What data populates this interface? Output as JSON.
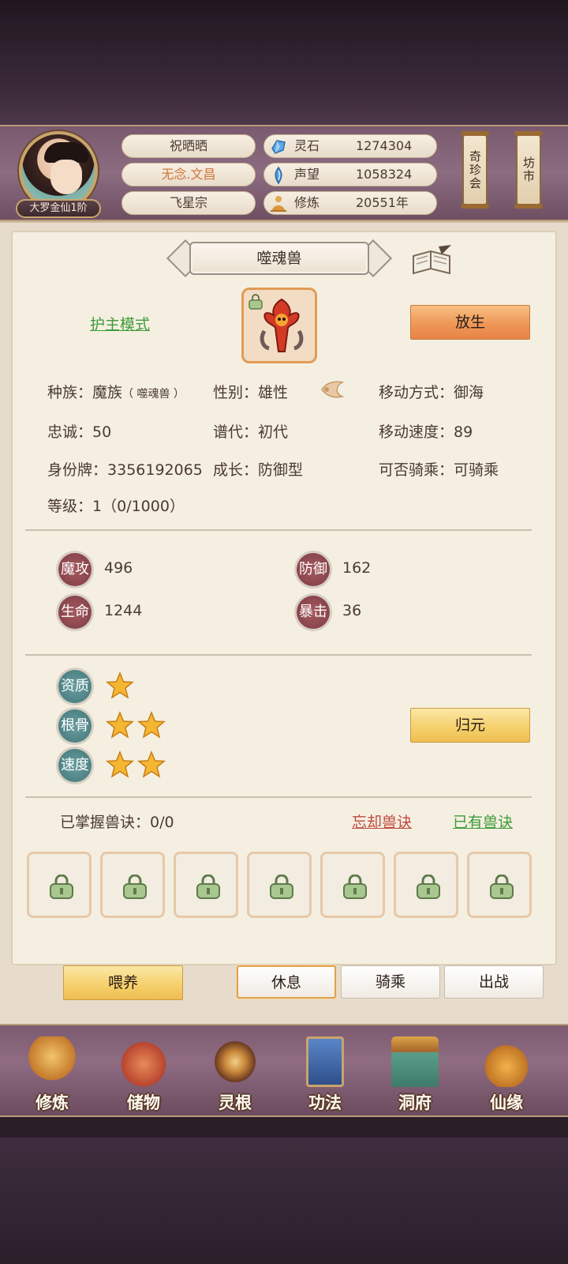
{
  "header": {
    "player_name": "祝晒晒",
    "title_name": "无念.文昌",
    "sect": "飞星宗",
    "rank": "大罗金仙1阶",
    "stats": [
      {
        "icon": "spirit-stone-icon",
        "label": "灵石",
        "value": "1274304"
      },
      {
        "icon": "reputation-icon",
        "label": "声望",
        "value": "1058324"
      },
      {
        "icon": "meditation-icon",
        "label": "修炼",
        "value": "20551年"
      }
    ],
    "right_buttons": [
      "奇珍会",
      "坊市"
    ]
  },
  "pet": {
    "name": "噬魂兽",
    "mode_link": "护主模式",
    "release_button": "放生",
    "info": {
      "race_label": "种族：",
      "race_value": "魔族",
      "race_sub": "（ 噬魂兽 ）",
      "gender_label": "性别：",
      "gender_value": "雄性",
      "move_label": "移动方式：",
      "move_value": "御海",
      "loyalty_label": "忠诚：",
      "loyalty_value": "50",
      "gen_label": "谱代：",
      "gen_value": "初代",
      "speed_label": "移动速度：",
      "speed_value": "89",
      "id_label": "身份牌：",
      "id_value": "3356192065",
      "growth_label": "成长：",
      "growth_value": "防御型",
      "ride_label": "可否骑乘：",
      "ride_value": "可骑乘",
      "level_label": "等级：",
      "level_value": "1（0/1000）"
    },
    "attrs": [
      {
        "label": "魔攻",
        "value": "496"
      },
      {
        "label": "防御",
        "value": "162"
      },
      {
        "label": "生命",
        "value": "1244"
      },
      {
        "label": "暴击",
        "value": "36"
      }
    ],
    "qualities": [
      {
        "label": "资质",
        "stars": 1
      },
      {
        "label": "根骨",
        "stars": 2
      },
      {
        "label": "速度",
        "stars": 2
      }
    ],
    "reset_button": "归元",
    "skills_mastered_label": "已掌握兽诀：",
    "skills_mastered_value": "0/0",
    "forget_link": "忘却兽诀",
    "owned_link": "已有兽诀",
    "skill_slots": 7
  },
  "actions": {
    "feed": "喂养",
    "rest": "休息",
    "ride": "骑乘",
    "fight": "出战"
  },
  "nav": [
    "修炼",
    "储物",
    "灵根",
    "功法",
    "洞府",
    "仙缘"
  ],
  "colors": {
    "accent_orange": "#ee9757",
    "accent_gold": "#f5cf6a",
    "link_green": "#3e9b39",
    "link_red": "#c0493f",
    "title_orange": "#d2743a"
  }
}
